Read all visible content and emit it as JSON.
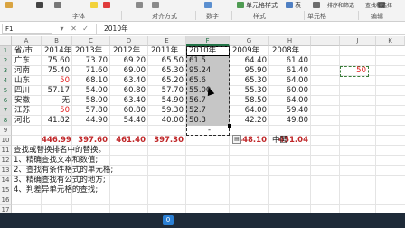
{
  "ribbon": {
    "top_labels": [
      "单元格样式",
      "表",
      "插入",
      "删除",
      "格式",
      "排序和筛选",
      "查找和选择"
    ],
    "group_labels": [
      "字体",
      "对齐方式",
      "数字",
      "样式",
      "单元格",
      "编辑"
    ],
    "icon_names": [
      "paste-icon",
      "bold-icon",
      "border-icon",
      "fill-color-icon",
      "font-color-icon",
      "align-icon",
      "wrap-icon",
      "number-format-icon",
      "cond-format-icon",
      "table-format-icon",
      "insert-icon",
      "sort-icon"
    ]
  },
  "formula_bar": {
    "name_box": "F1",
    "buttons": [
      "▾",
      "✕",
      "✓",
      "fx"
    ],
    "value": "2010年"
  },
  "columns": [
    "A",
    "B",
    "C",
    "D",
    "E",
    "F",
    "G",
    "H",
    "I",
    "J",
    "K"
  ],
  "rows": [
    "1",
    "2",
    "3",
    "4",
    "5",
    "6",
    "7",
    "8",
    "9",
    "10",
    "11",
    "12",
    "13",
    "14",
    "15",
    "16",
    "17",
    "18",
    "19",
    "20"
  ],
  "table": {
    "header": [
      "省/市",
      "2014年",
      "2013年",
      "2012年",
      "2011年",
      "2010年",
      "2009年",
      "2008年"
    ],
    "rows": [
      [
        "广东",
        "75.60",
        "73.70",
        "69.20",
        "65.50",
        "61.5",
        "64.40",
        "61.40"
      ],
      [
        "河南",
        "75.40",
        "71.60",
        "69.00",
        "65.30",
        "95.24",
        "95.90",
        "61.40"
      ],
      [
        "山东",
        "50",
        "68.10",
        "63.40",
        "65.20",
        "65.6",
        "65.30",
        "64.00"
      ],
      [
        "四川",
        "57.17",
        "54.00",
        "60.80",
        "57.70",
        "55.00",
        "55.30",
        "60.00"
      ],
      [
        "安徽",
        "无",
        "58.00",
        "63.40",
        "54.90",
        "56.7",
        "58.50",
        "64.00"
      ],
      [
        "江苏",
        "50",
        "57.80",
        "60.80",
        "59.30",
        "52.7",
        "64.00",
        "59.40"
      ],
      [
        "河北",
        "41.82",
        "44.90",
        "54.40",
        "40.00",
        "50.3",
        "42.20",
        "49.80"
      ]
    ],
    "red_cells": [
      "2-1",
      "5-1"
    ],
    "dash_cell_f10": "-",
    "totals": [
      "446.99",
      "397.60",
      "461.40",
      "397.30",
      "",
      "448.10",
      "451.04"
    ],
    "h11": "中国",
    "j6": "50"
  },
  "notes": [
    "查找或替换排名中的替换。",
    "1、精确查找文本和数值;",
    "2、查找有条件格式的单元格;",
    "3、精确查找有公式的地方;",
    "4、判差异单元格的查找;"
  ],
  "taskbar": {
    "app_label": "0",
    "text": "http://..."
  },
  "colors": {
    "accent": "#217346",
    "red_value": "#e21b1b",
    "totals": "#c0282a",
    "selection": "#c6c6c6"
  }
}
